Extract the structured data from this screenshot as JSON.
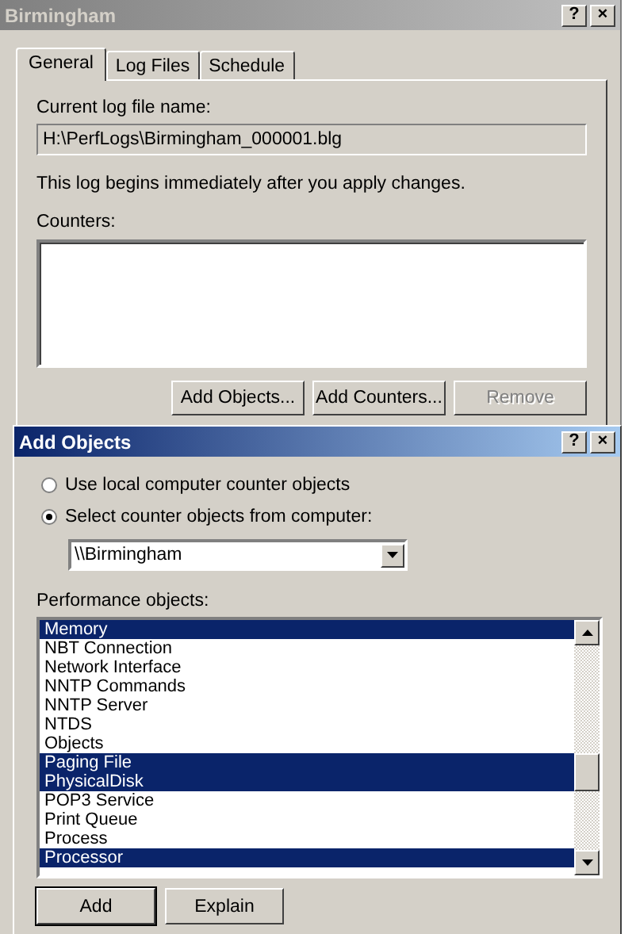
{
  "window": {
    "title": "Birmingham",
    "help_button": "?",
    "close_button": "×"
  },
  "tabs": [
    {
      "label": "General",
      "selected": true
    },
    {
      "label": "Log Files",
      "selected": false
    },
    {
      "label": "Schedule",
      "selected": false
    }
  ],
  "log_file": {
    "label": "Current log file name:",
    "value": "H:\\PerfLogs\\Birmingham_000001.blg"
  },
  "note": "This log begins immediately after you apply changes.",
  "counters": {
    "label": "Counters:"
  },
  "counter_buttons": [
    {
      "label": "Add Objects...",
      "disabled": false
    },
    {
      "label": "Add Counters...",
      "disabled": false
    },
    {
      "label": "Remove",
      "disabled": true
    }
  ],
  "dialog": {
    "title": "Add Objects",
    "help_button": "?",
    "close_button": "×",
    "sources": [
      {
        "label": "Use local computer counter objects",
        "selected": false
      },
      {
        "label": "Select counter objects from computer:",
        "selected": true
      }
    ],
    "computer": {
      "value": "\\\\Birmingham"
    },
    "objects_label": "Performance objects:",
    "objects": [
      {
        "label": "Memory",
        "selected": true
      },
      {
        "label": "NBT Connection",
        "selected": false
      },
      {
        "label": "Network Interface",
        "selected": false
      },
      {
        "label": "NNTP Commands",
        "selected": false
      },
      {
        "label": "NNTP Server",
        "selected": false
      },
      {
        "label": "NTDS",
        "selected": false
      },
      {
        "label": "Objects",
        "selected": false
      },
      {
        "label": "Paging File",
        "selected": true
      },
      {
        "label": "PhysicalDisk",
        "selected": true
      },
      {
        "label": "POP3 Service",
        "selected": false
      },
      {
        "label": "Print Queue",
        "selected": false
      },
      {
        "label": "Process",
        "selected": false
      },
      {
        "label": "Processor",
        "selected": true
      }
    ],
    "buttons": [
      {
        "label": "Add",
        "default": true
      },
      {
        "label": "Explain",
        "default": false
      }
    ]
  }
}
